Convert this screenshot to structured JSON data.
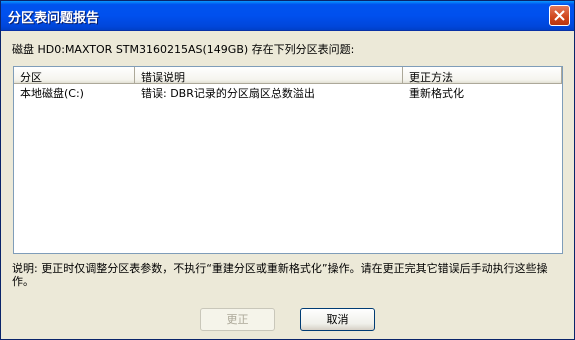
{
  "window": {
    "title": "分区表问题报告"
  },
  "message": "磁盘 HD0:MAXTOR STM3160215AS(149GB) 存在下列分区表问题:",
  "table": {
    "columns": [
      "分区",
      "错误说明",
      "更正方法"
    ],
    "rows": [
      [
        "本地磁盘(C:)",
        "错误: DBR记录的分区扇区总数溢出",
        "重新格式化"
      ]
    ]
  },
  "note": "说明: 更正时仅调整分区表参数，不执行“重建分区或重新格式化”操作。请在更正完其它错误后手动执行这些操作。",
  "buttons": {
    "fix": "更正",
    "cancel": "取消"
  },
  "icons": {
    "close": "close-icon"
  },
  "colors": {
    "titlebar": "#0053ee",
    "background": "#ece9d8",
    "close_button": "#d0461c"
  }
}
